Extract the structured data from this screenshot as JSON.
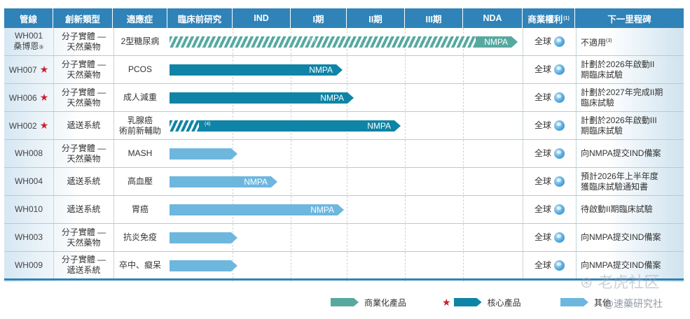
{
  "header": {
    "pipeline": "管線",
    "innovation_type": "創新類型",
    "indication": "適應症",
    "preclinical": "臨床前研究",
    "ind": "IND",
    "phase1": "I期",
    "phase2": "II期",
    "phase3": "III期",
    "nda": "NDA",
    "rights": "商業權利",
    "rights_note": "(1)",
    "milestone": "下一里程碑"
  },
  "rows": [
    {
      "pipeline": "WH001",
      "pipeline_sub": "桑博恩",
      "pipeline_mark": "⑨",
      "core": false,
      "type_line1": "分子實體 —",
      "type_line2": "天然藥物",
      "indication": "2型糖尿病",
      "indication2": "",
      "bar": {
        "style": "commercial",
        "hatched_until": "NDA",
        "label": "NMPA",
        "note": "(2)",
        "progress": 1.0
      },
      "rights": "全球",
      "milestone": "不適用",
      "milestone_note": "(3)",
      "milestone2": ""
    },
    {
      "pipeline": "WH007",
      "core": true,
      "type_line1": "分子實體 —",
      "type_line2": "天然藥物",
      "indication": "PCOS",
      "indication2": "",
      "bar": {
        "style": "core",
        "label": "NMPA",
        "progress": 0.497
      },
      "rights": "全球",
      "milestone": "計劃於2026年啟動II",
      "milestone2": "期臨床試驗"
    },
    {
      "pipeline": "WH006",
      "core": true,
      "type_line1": "分子實體 —",
      "type_line2": "天然藥物",
      "indication": "成人減重",
      "indication2": "",
      "bar": {
        "style": "core",
        "label": "NMPA",
        "progress": 0.53
      },
      "rights": "全球",
      "milestone": "計劃於2027年完成II期",
      "milestone2": "臨床試驗"
    },
    {
      "pipeline": "WH002",
      "core": true,
      "type_line1": "遞送系統",
      "type_line2": "",
      "indication": "乳腺癌",
      "indication2": "術前新輔助",
      "bar": {
        "style": "core",
        "hatched": true,
        "label": "NMPA",
        "note": "(4)",
        "progress": 0.664
      },
      "rights": "全球",
      "milestone": "計劃於2026年啟動III",
      "milestone2": "期臨床試驗"
    },
    {
      "pipeline": "WH008",
      "core": false,
      "type_line1": "分子實體 —",
      "type_line2": "天然藥物",
      "indication": "MASH",
      "indication2": "",
      "bar": {
        "style": "other",
        "label": "",
        "progress": 0.195
      },
      "rights": "全球",
      "milestone": "向NMPA提交IND備案",
      "milestone2": ""
    },
    {
      "pipeline": "WH004",
      "core": false,
      "type_line1": "遞送系統",
      "type_line2": "",
      "indication": "高血壓",
      "indication2": "",
      "bar": {
        "style": "other",
        "label": "NMPA",
        "progress": 0.31
      },
      "rights": "全球",
      "milestone": "預計2026年上半年度",
      "milestone2": "獲臨床試驗通知書"
    },
    {
      "pipeline": "WH010",
      "core": false,
      "type_line1": "遞送系統",
      "type_line2": "",
      "indication": "胃癌",
      "indication2": "",
      "bar": {
        "style": "other",
        "label": "NMPA",
        "progress": 0.5
      },
      "rights": "全球",
      "milestone": "待啟動II期臨床試驗",
      "milestone2": ""
    },
    {
      "pipeline": "WH003",
      "core": false,
      "type_line1": "分子實體 —",
      "type_line2": "天然藥物",
      "indication": "抗炎免疫",
      "indication2": "",
      "bar": {
        "style": "other",
        "label": "",
        "progress": 0.195
      },
      "rights": "全球",
      "milestone": "向NMPA提交IND備案",
      "milestone2": ""
    },
    {
      "pipeline": "WH009",
      "core": false,
      "type_line1": "分子實體 —",
      "type_line2": "遞送系統",
      "indication": "卒中、癡呆",
      "indication2": "",
      "bar": {
        "style": "other",
        "label": "",
        "progress": 0.195
      },
      "rights": "全球",
      "milestone": "向NMPA提交IND備案",
      "milestone2": ""
    }
  ],
  "legend": {
    "commercial": "商業化產品",
    "core": "核心產品",
    "other": "其他"
  },
  "watermark": {
    "main": "老虎社区",
    "sub": "@速藥研究社"
  },
  "colors": {
    "header": "#2f83b8",
    "commercial": "#57a9a0",
    "core": "#0f84a6",
    "other": "#6db7df",
    "star": "#c8202f"
  }
}
